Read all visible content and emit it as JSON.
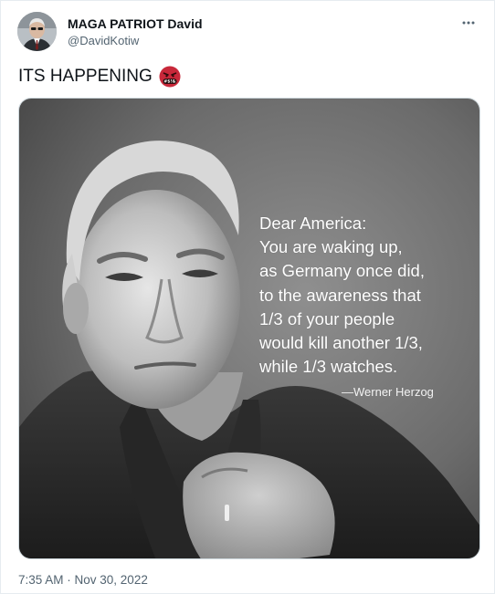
{
  "tweet": {
    "author": {
      "display_name": "MAGA PATRIOT David",
      "handle": "@DavidKotiw"
    },
    "text": "ITS HAPPENING",
    "emoji": "face-with-symbols-on-mouth",
    "image": {
      "quote_lines": [
        "Dear America:",
        "You are waking up,",
        "as Germany once did,",
        "to the awareness that",
        "1/3 of your people",
        "would kill another 1/3,",
        "while 1/3 watches."
      ],
      "attribution": "—Werner Herzog"
    },
    "timestamp": "7:35 AM · Nov 30, 2022",
    "more_icon": "more-horizontal-icon"
  }
}
